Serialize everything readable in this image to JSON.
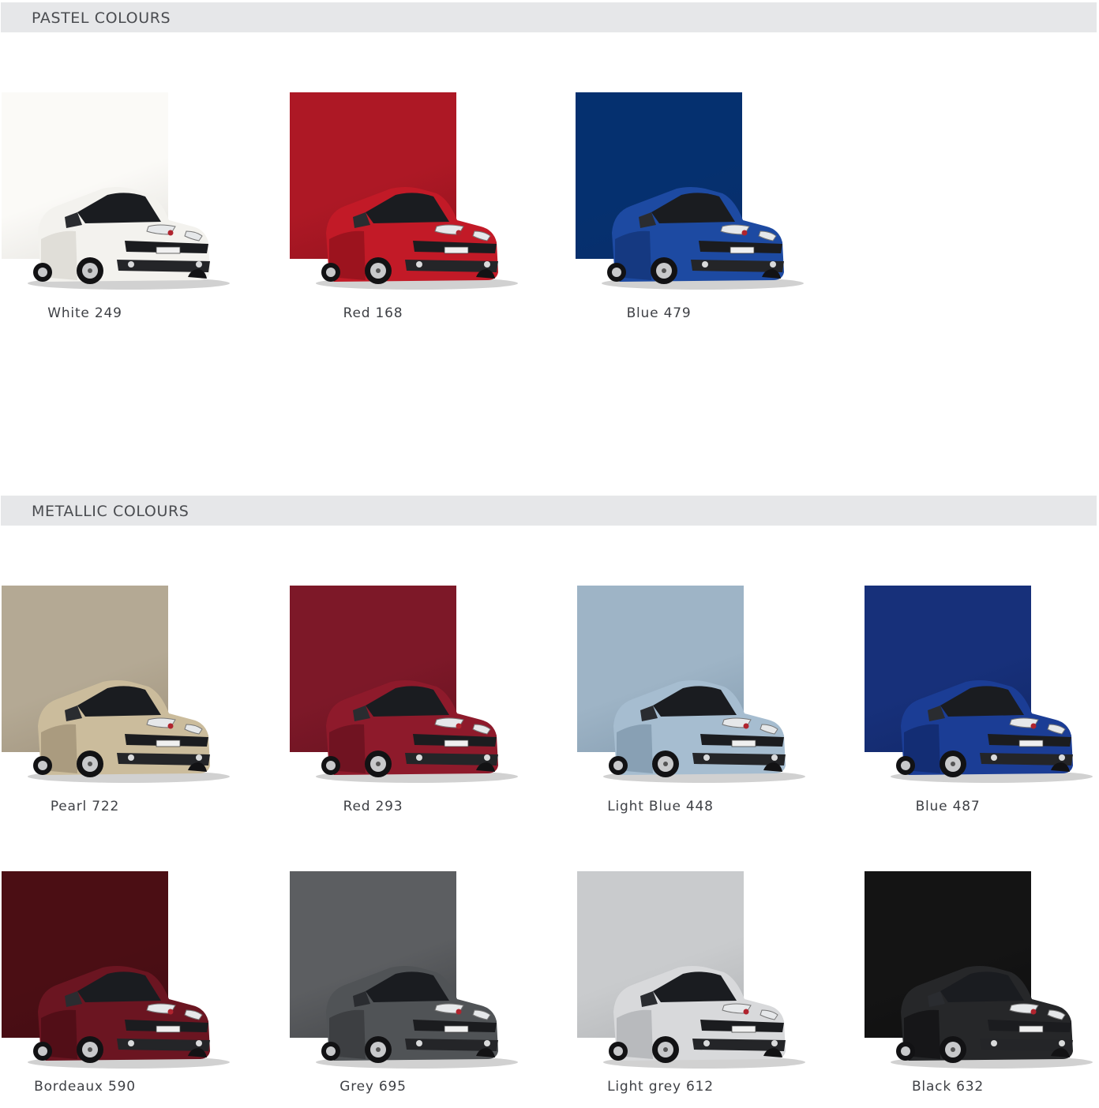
{
  "sections": [
    {
      "title": "PASTEL COLOURS",
      "colours": [
        {
          "name": "White 249",
          "swatch": "#fbfaf7",
          "body": "#f3f2ee",
          "shade": "#cfcdc7"
        },
        {
          "name": "Red 168",
          "swatch": "#ad1825",
          "body": "#c21a27",
          "shade": "#7d0f17"
        },
        {
          "name": "Blue 479",
          "swatch": "#05306f",
          "body": "#1d4aa2",
          "shade": "#0e2c66"
        }
      ]
    },
    {
      "title": "METALLIC COLOURS",
      "colours": [
        {
          "name": "Pearl 722",
          "swatch": "#b4a994",
          "body": "#cbbc9c",
          "shade": "#8f8068"
        },
        {
          "name": "Red 293",
          "swatch": "#7d1828",
          "body": "#8e1a2b",
          "shade": "#570e19"
        },
        {
          "name": "Light Blue 448",
          "swatch": "#9eb4c6",
          "body": "#a6bdd0",
          "shade": "#6f889d"
        },
        {
          "name": "Blue 487",
          "swatch": "#17307a",
          "body": "#1b3d95",
          "shade": "#0d2159"
        },
        {
          "name": "Bordeaux 590",
          "swatch": "#4b0e14",
          "body": "#6b1521",
          "shade": "#3e0a11"
        },
        {
          "name": "Grey 695",
          "swatch": "#5c5e61",
          "body": "#505356",
          "shade": "#2e3033"
        },
        {
          "name": "Light grey 612",
          "swatch": "#c9cbcd",
          "body": "#d8d9db",
          "shade": "#9fa1a4"
        },
        {
          "name": "Black 632",
          "swatch": "#141414",
          "body": "#262729",
          "shade": "#0a0a0b"
        }
      ]
    }
  ]
}
